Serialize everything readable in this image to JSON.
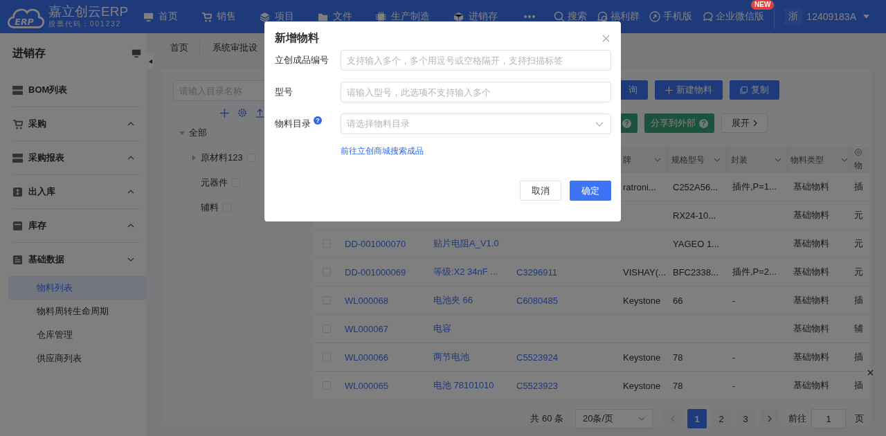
{
  "header": {
    "logo_mark": "ERP",
    "brand": "嘉立创云ERP",
    "stock_code": "股票代码：001232",
    "nav": [
      {
        "label": "首页"
      },
      {
        "label": "销售"
      },
      {
        "label": "项目"
      },
      {
        "label": "文件"
      },
      {
        "label": "生产制造"
      },
      {
        "label": "进销存"
      }
    ],
    "more": "•••",
    "tools": [
      {
        "label": "搜索"
      },
      {
        "label": "福利群"
      },
      {
        "label": "手机版"
      },
      {
        "label": "企业微信版",
        "badge": "NEW"
      }
    ],
    "region": "浙",
    "account": "12409183A"
  },
  "sidebar": {
    "title": "进销存",
    "groups": [
      {
        "label": "BOM列表"
      },
      {
        "label": "采购",
        "expanded": false
      },
      {
        "label": "采购报表",
        "expanded": false
      },
      {
        "label": "出入库",
        "expanded": false
      },
      {
        "label": "库存",
        "expanded": false
      },
      {
        "label": "基础数据",
        "expanded": true,
        "children": [
          {
            "label": "物料列表",
            "selected": true
          },
          {
            "label": "物料周转生命周期",
            "selected": false
          },
          {
            "label": "仓库管理",
            "selected": false
          },
          {
            "label": "供应商列表",
            "selected": false
          }
        ]
      }
    ]
  },
  "breadcrumb": [
    "首页",
    "系统审批设"
  ],
  "tree": {
    "placeholder": "请输入目录名称",
    "root": {
      "label": "全部",
      "expanded": true,
      "children": [
        {
          "label": "原材料123",
          "expanded": false,
          "checked": false
        },
        {
          "label": "元器件",
          "checked": false
        },
        {
          "label": "辅料",
          "checked": false
        }
      ]
    }
  },
  "toolbar": [
    [
      {
        "label": "询",
        "kind": "primary"
      },
      {
        "label": "新建物料",
        "kind": "primary"
      },
      {
        "label": "复制",
        "kind": "primary"
      }
    ],
    [
      {
        "kind": "success",
        "help": "?"
      },
      {
        "label": "分享到外部",
        "kind": "success",
        "help": "?"
      },
      {
        "label": "展开",
        "kind": "plain"
      }
    ]
  ],
  "table": {
    "columns": [
      {
        "label": "牌",
        "filter": true
      },
      {
        "label": "规格型号",
        "filter": true
      },
      {
        "label": "封装",
        "filter": true
      },
      {
        "label": "物料类型",
        "filter": true
      },
      {
        "label": "物",
        "settings": true
      }
    ],
    "rows": [
      {
        "brand": "ratroni...",
        "spec": "C252A56...",
        "package": "插件,P=1...",
        "type": "基础物料",
        "category": "插"
      },
      {
        "spec": "RX24-10...",
        "type": "基础物料",
        "category": "元"
      },
      {
        "checked": false,
        "code": "DD-001000070",
        "name": "贴片电阻A_V1.0",
        "spec": "YAGEO 1...",
        "type": "基础物料",
        "category": "元"
      },
      {
        "checked": false,
        "code": "DD-001000069",
        "name": "等级:X2 34nF ...",
        "lcsc": "C3296911",
        "brand": "VISHAY(...",
        "spec": "BFC2338...",
        "package": "插件,P=2...",
        "type": "基础物料",
        "category": "元"
      },
      {
        "checked": false,
        "code": "WL000068",
        "name": "电池夹 66",
        "lcsc": "C6080485",
        "brand": "Keystone",
        "spec": "66",
        "package": "-",
        "type": "基础物料",
        "category": "插"
      },
      {
        "checked": false,
        "code": "WL000067",
        "name": "电容",
        "type": "基础物料",
        "category": "辅"
      },
      {
        "checked": false,
        "code": "WL000066",
        "name": "两节电池",
        "lcsc": "C5523924",
        "brand": "Keystone",
        "spec": "78",
        "package": "-",
        "type": "基础物料",
        "category": "插"
      },
      {
        "checked": false,
        "code": "WL000065",
        "name": "电池 78101010",
        "lcsc": "C5523923",
        "brand": "Keystone",
        "spec": "78",
        "package": "-",
        "type": "基础物料",
        "category": "插"
      }
    ]
  },
  "pagination": {
    "total": "共 60 条",
    "page_size": "20条/页",
    "pages": [
      {
        "label": "1",
        "selected": true
      },
      {
        "label": "2",
        "selected": false
      },
      {
        "label": "3",
        "selected": false
      }
    ],
    "goto_label": "前往",
    "goto_value": "1",
    "goto_suffix": "页"
  },
  "modal": {
    "title": "新增物料",
    "fields": [
      {
        "label": "立创成品编号",
        "kind": "input",
        "placeholder": "支持输入多个，多个用逗号或空格隔开，支持扫描标签"
      },
      {
        "label": "型号",
        "kind": "input",
        "placeholder": "请输入型号，此选项不支持输入多个"
      },
      {
        "label": "物料目录",
        "kind": "select",
        "help": "?",
        "placeholder": "请选择物料目录"
      }
    ],
    "link": "前往立创商城搜索成品",
    "buttons": [
      {
        "label": "取消",
        "kind": "default"
      },
      {
        "label": "确定",
        "kind": "primary"
      }
    ]
  }
}
